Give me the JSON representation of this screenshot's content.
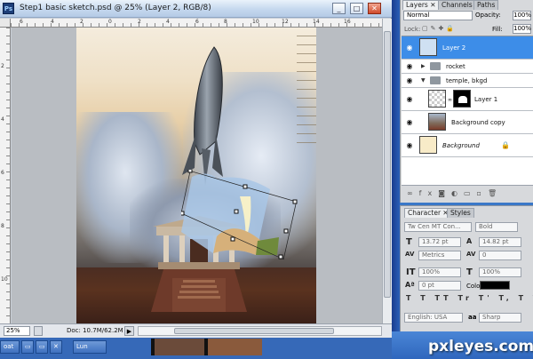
{
  "document": {
    "title": "Step1 basic sketch.psd @ 25% (Layer 2, RGB/8)",
    "zoom": "25%",
    "doc_size": "Doc: 10.7M/62.2M",
    "ruler_top_numbers": [
      "6",
      "4",
      "2",
      "0",
      "2",
      "4",
      "6",
      "8",
      "10",
      "12",
      "14",
      "16"
    ],
    "ruler_left_numbers": [
      "2",
      "4",
      "6",
      "8",
      "10"
    ]
  },
  "window_controls": {
    "minimize": "_",
    "maximize": "□",
    "close": "✕"
  },
  "taskbar": {
    "items": [
      "oat",
      "Lun"
    ]
  },
  "layers_panel": {
    "tabs": [
      "Layers ✕",
      "Channels",
      "Paths"
    ],
    "blend_mode": "Normal",
    "opacity_label": "Opacity:",
    "opacity_value": "100%",
    "lock_label": "Lock:",
    "fill_label": "Fill:",
    "fill_value": "100%",
    "layers": [
      {
        "name": "Layer 2",
        "selected": true,
        "kind": "layer"
      },
      {
        "name": "rocket",
        "selected": false,
        "kind": "group",
        "expanded": false
      },
      {
        "name": "temple, bkgd",
        "selected": false,
        "kind": "group",
        "expanded": true
      },
      {
        "name": "Layer 1",
        "selected": false,
        "kind": "masked-layer"
      },
      {
        "name": "Background copy",
        "selected": false,
        "kind": "layer"
      },
      {
        "name": "Background",
        "selected": false,
        "kind": "background",
        "locked": true
      }
    ],
    "bottom_icons": [
      "link-icon",
      "fx-icon",
      "mask-icon",
      "adjustment-icon",
      "folder-icon",
      "new-layer-icon",
      "trash-icon"
    ]
  },
  "character_panel": {
    "tabs": [
      "Character ✕",
      "Styles"
    ],
    "font_family": "Tw Cen MT Con...",
    "font_style": "Bold",
    "font_size": "13.72 pt",
    "leading": "14.82 pt",
    "kerning": "Metrics",
    "tracking": "0",
    "vertical_scale": "100%",
    "horizontal_scale": "100%",
    "baseline_shift": "0 pt",
    "color_label": "Color:",
    "color_value": "#000000",
    "style_buttons": [
      "T",
      "T",
      "TT",
      "Tr",
      "T'",
      "T,",
      "T",
      "T"
    ],
    "language": "English: USA",
    "antialias_glyph": "aa",
    "antialias": "Sharp"
  },
  "watermark": "pxleyes.com"
}
